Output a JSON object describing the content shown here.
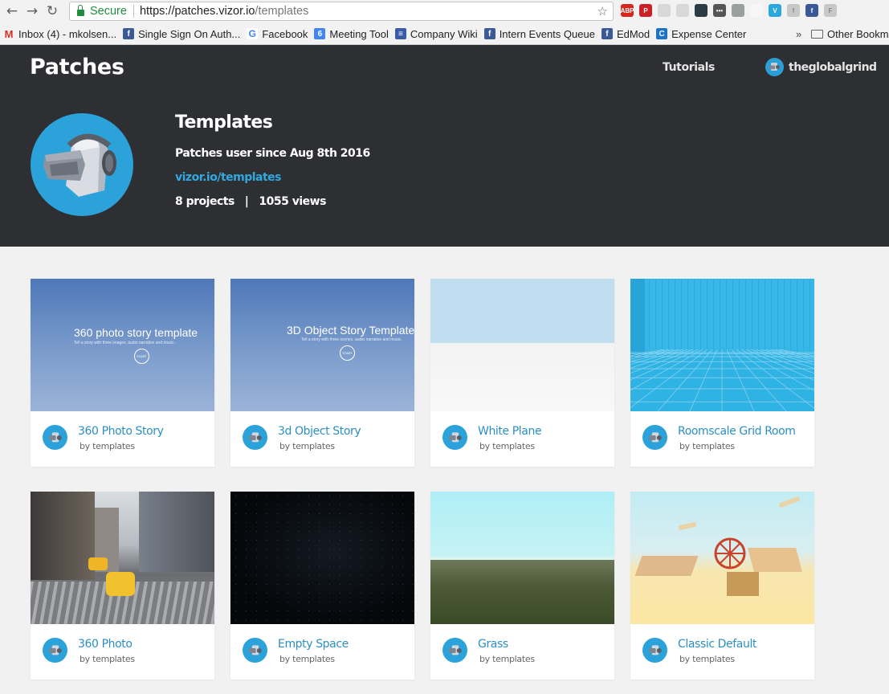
{
  "browser": {
    "secure_label": "Secure",
    "url_scheme_host": "https://patches.vizor.io",
    "url_path": "/templates",
    "extensions": [
      {
        "name": "adblock-icon",
        "label": "ABP",
        "color": "#d8261f"
      },
      {
        "name": "pinterest-icon",
        "label": "P",
        "color": "#cb2027"
      },
      {
        "name": "ext-grey-1-icon",
        "label": "",
        "color": "#d8d8d8"
      },
      {
        "name": "ext-grey-2-icon",
        "label": "",
        "color": "#d8d8d8"
      },
      {
        "name": "ext-dark-icon",
        "label": "",
        "color": "#2d3b45"
      },
      {
        "name": "ext-dots-icon",
        "label": "•••",
        "color": "#555555"
      },
      {
        "name": "ext-grey-3-icon",
        "label": "",
        "color": "#9aa09d"
      },
      {
        "name": "ext-arc-icon",
        "label": "",
        "color": "#f7f7f7"
      },
      {
        "name": "ext-v-icon",
        "label": "V",
        "color": "#2aa7dd"
      },
      {
        "name": "facebook-grey-icon",
        "label": "f",
        "color": "#c8c8c8"
      },
      {
        "name": "facebook-ext-icon",
        "label": "f",
        "color": "#3b5998"
      },
      {
        "name": "ext-f-grey-icon",
        "label": "F",
        "color": "#c8c8c8"
      }
    ],
    "bookmarks": [
      {
        "name": "bookmark-inbox",
        "icon": "gmail-icon",
        "icon_label": "M",
        "icon_color": "#d93025",
        "label": "Inbox (4) - mkolsen..."
      },
      {
        "name": "bookmark-sso",
        "icon": "facebook-icon",
        "icon_label": "f",
        "icon_color": "#3b5998",
        "label": "Single Sign On Auth..."
      },
      {
        "name": "bookmark-facebook",
        "icon": "google-icon",
        "icon_label": "G",
        "icon_color": "#ffffff",
        "label": "Facebook"
      },
      {
        "name": "bookmark-meeting-tool",
        "icon": "calendar-icon",
        "icon_label": "6",
        "icon_color": "#4285f4",
        "label": "Meeting Tool"
      },
      {
        "name": "bookmark-company-wiki",
        "icon": "wiki-icon",
        "icon_label": "≡",
        "icon_color": "#3a5ba8",
        "label": "Company Wiki"
      },
      {
        "name": "bookmark-intern-events",
        "icon": "facebook-icon",
        "icon_label": "f",
        "icon_color": "#3b5998",
        "label": "Intern Events Queue"
      },
      {
        "name": "bookmark-edmod",
        "icon": "facebook-icon",
        "icon_label": "f",
        "icon_color": "#3b5998",
        "label": "EdMod"
      },
      {
        "name": "bookmark-expense-center",
        "icon": "expense-icon",
        "icon_label": "C",
        "icon_color": "#1a73c8",
        "label": "Expense Center"
      }
    ],
    "more_label": "»",
    "other_bookmarks": "Other Bookmarks"
  },
  "header": {
    "logo": "Patches",
    "tutorials": "Tutorials",
    "username": "theglobalgrind"
  },
  "profile": {
    "name": "Templates",
    "since": "Patches user since Aug 8th 2016",
    "url": "vizor.io/templates",
    "projects": "8 projects",
    "divider": "|",
    "views": "1055 views"
  },
  "projects": [
    {
      "title": "360 Photo Story",
      "by": "by templates",
      "thumb": "photo-story",
      "overlay_title": "360 photo story template",
      "overlay_sub": "Tell a story with three images, audio narrative and music."
    },
    {
      "title": "3d Object Story",
      "by": "by templates",
      "thumb": "object-story",
      "overlay_title": "3D Object Story Template",
      "overlay_sub": "Tell a story with three scenes, audio narrative and music."
    },
    {
      "title": "White Plane",
      "by": "by templates",
      "thumb": "white-plane"
    },
    {
      "title": "Roomscale Grid Room",
      "by": "by templates",
      "thumb": "grid-room"
    },
    {
      "title": "360 Photo",
      "by": "by templates",
      "thumb": "street"
    },
    {
      "title": "Empty Space",
      "by": "by templates",
      "thumb": "space"
    },
    {
      "title": "Grass",
      "by": "by templates",
      "thumb": "grass"
    },
    {
      "title": "Classic Default",
      "by": "by templates",
      "thumb": "desert"
    }
  ],
  "overlay_button": "START"
}
